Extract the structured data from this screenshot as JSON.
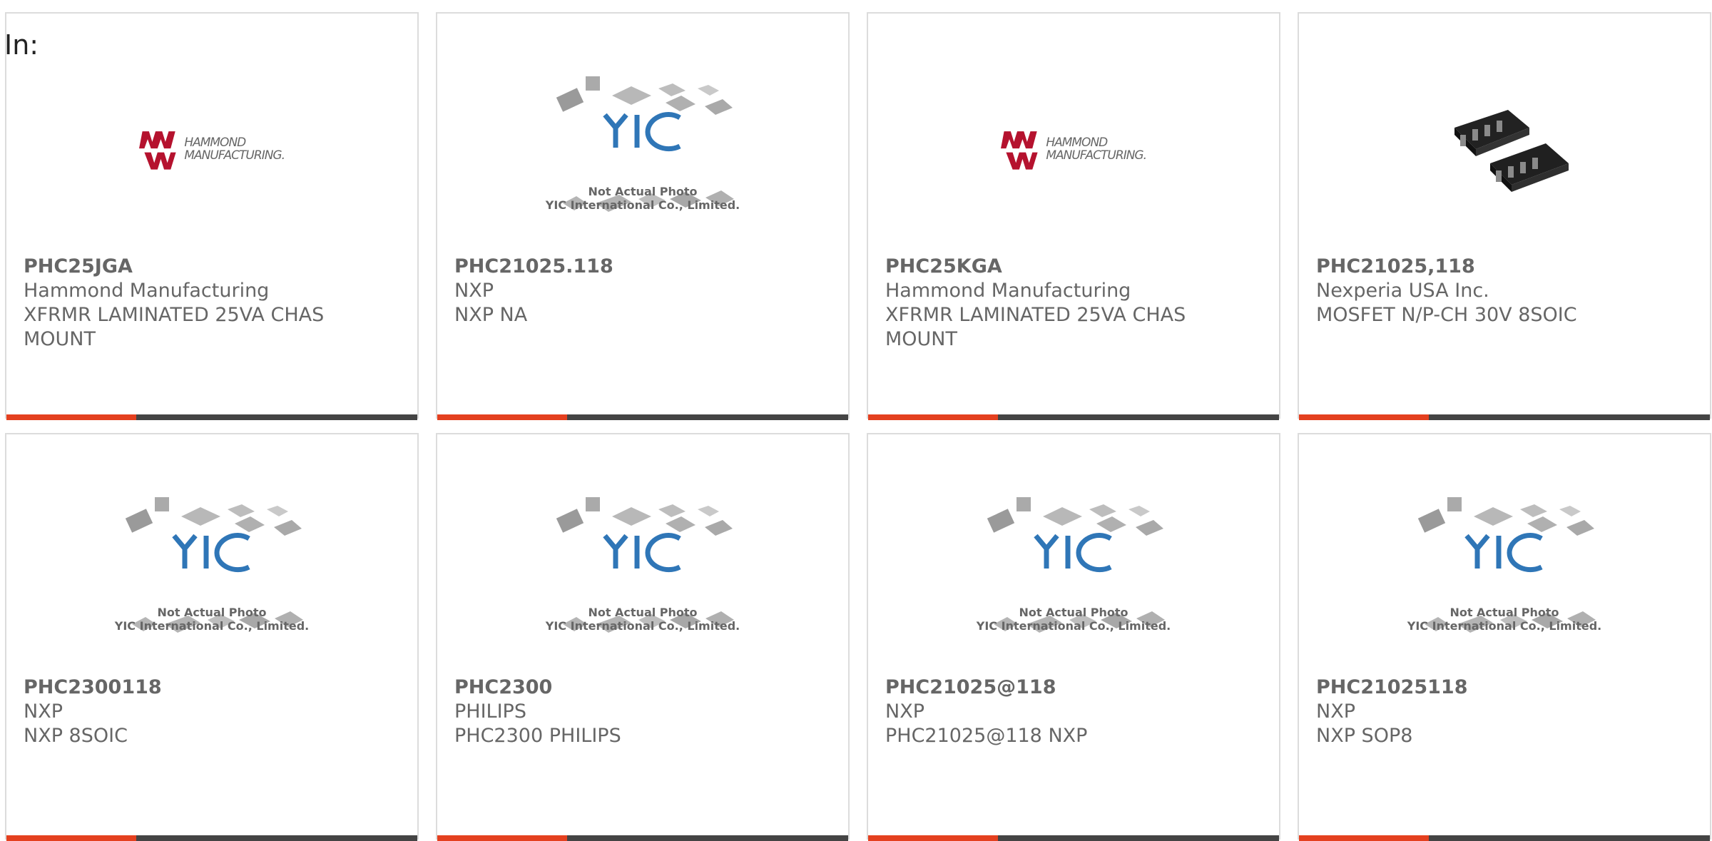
{
  "header": {
    "label": "In:"
  },
  "colors": {
    "accent": "#e4401f",
    "bar": "#444444",
    "yic_blue": "#2f76b7",
    "hammond_red": "#b5122e"
  },
  "cards": [
    {
      "part_number": "PHC25JGA",
      "manufacturer": "Hammond Manufacturing",
      "description": "XFRMR LAMINATED 25VA CHAS MOUNT",
      "image_type": "hammond-logo",
      "logo_text_1": "HAMMOND",
      "logo_text_2": "MANUFACTURING."
    },
    {
      "part_number": "PHC21025.118",
      "manufacturer": "NXP",
      "description": "NXP NA",
      "image_type": "not-actual-photo",
      "caption_1": "Not Actual Photo",
      "caption_2": "YIC International Co., Limited."
    },
    {
      "part_number": "PHC25KGA",
      "manufacturer": "Hammond Manufacturing",
      "description": "XFRMR LAMINATED 25VA CHAS MOUNT",
      "image_type": "hammond-logo",
      "logo_text_1": "HAMMOND",
      "logo_text_2": "MANUFACTURING."
    },
    {
      "part_number": "PHC21025,118",
      "manufacturer": "Nexperia USA Inc.",
      "description": "MOSFET N/P-CH 30V 8SOIC",
      "image_type": "chip-photo"
    },
    {
      "part_number": "PHC2300118",
      "manufacturer": "NXP",
      "description": "NXP 8SOIC",
      "image_type": "not-actual-photo",
      "caption_1": "Not Actual Photo",
      "caption_2": "YIC International Co., Limited."
    },
    {
      "part_number": "PHC2300",
      "manufacturer": "PHILIPS",
      "description": "PHC2300 PHILIPS",
      "image_type": "not-actual-photo",
      "caption_1": "Not Actual Photo",
      "caption_2": "YIC International Co., Limited."
    },
    {
      "part_number": "PHC21025@118",
      "manufacturer": "NXP",
      "description": "PHC21025@118 NXP",
      "image_type": "not-actual-photo",
      "caption_1": "Not Actual Photo",
      "caption_2": "YIC International Co., Limited."
    },
    {
      "part_number": "PHC21025118",
      "manufacturer": "NXP",
      "description": "NXP SOP8",
      "image_type": "not-actual-photo",
      "caption_1": "Not Actual Photo",
      "caption_2": "YIC International Co., Limited."
    }
  ]
}
